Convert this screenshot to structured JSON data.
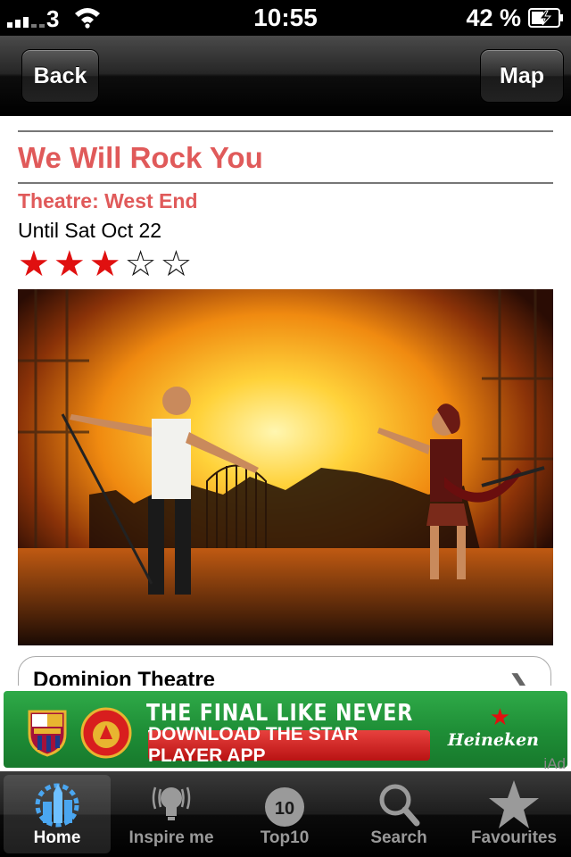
{
  "status_bar": {
    "carrier": "3",
    "time": "10:55",
    "battery": "42 %"
  },
  "nav": {
    "back_label": "Back",
    "map_label": "Map"
  },
  "show": {
    "title": "We Will Rock You",
    "category": "Theatre: West End",
    "dates": "Until Sat Oct 22",
    "rating": 3,
    "rating_max": 5,
    "venue": "Dominion Theatre"
  },
  "ad": {
    "headline": "THE FINAL LIKE NEVER BEFORE",
    "cta": "DOWNLOAD THE STAR PLAYER APP",
    "brand": "Heineken",
    "tag": "iAd"
  },
  "tabs": [
    {
      "label": "Home",
      "icon": "home-icon",
      "active": true
    },
    {
      "label": "Inspire me",
      "icon": "lightbulb-icon",
      "active": false
    },
    {
      "label": "Top10",
      "icon": "top10-icon",
      "badge": "10",
      "active": false
    },
    {
      "label": "Search",
      "icon": "search-icon",
      "active": false
    },
    {
      "label": "Favourites",
      "icon": "star-icon",
      "active": false
    }
  ],
  "colors": {
    "accent": "#e05a5a",
    "star_fill": "#e01010"
  }
}
